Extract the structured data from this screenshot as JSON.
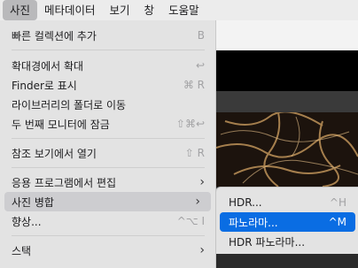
{
  "menubar": {
    "items": [
      "사진",
      "메타데이터",
      "보기",
      "창",
      "도움말"
    ]
  },
  "menu": {
    "items": [
      {
        "label": "빠른 컬렉션에 추가",
        "shortcut": "B"
      },
      {
        "label": "확대경에서 확대",
        "shortcut": "↩"
      },
      {
        "label": "Finder로 표시",
        "shortcut": "⌘ R"
      },
      {
        "label": "라이브러리의 폴더로 이동",
        "shortcut": ""
      },
      {
        "label": "두 번째 모니터에 잠금",
        "shortcut": "⇧⌘↩"
      },
      {
        "label": "참조 보기에서 열기",
        "shortcut": "⇧ R"
      },
      {
        "label": "응용 프로그램에서 편집",
        "shortcut": ""
      },
      {
        "label": "사진 병합",
        "shortcut": ""
      },
      {
        "label": "향상...",
        "shortcut": "^⌥ I"
      },
      {
        "label": "스택",
        "shortcut": ""
      }
    ]
  },
  "submenu": {
    "items": [
      {
        "label": "HDR...",
        "shortcut": "^H"
      },
      {
        "label": "파노라마...",
        "shortcut": "^M"
      },
      {
        "label": "HDR 파노라마...",
        "shortcut": ""
      }
    ]
  },
  "colors": {
    "selection": "#0a6de3",
    "menu_bg": "#e3e3e3"
  }
}
